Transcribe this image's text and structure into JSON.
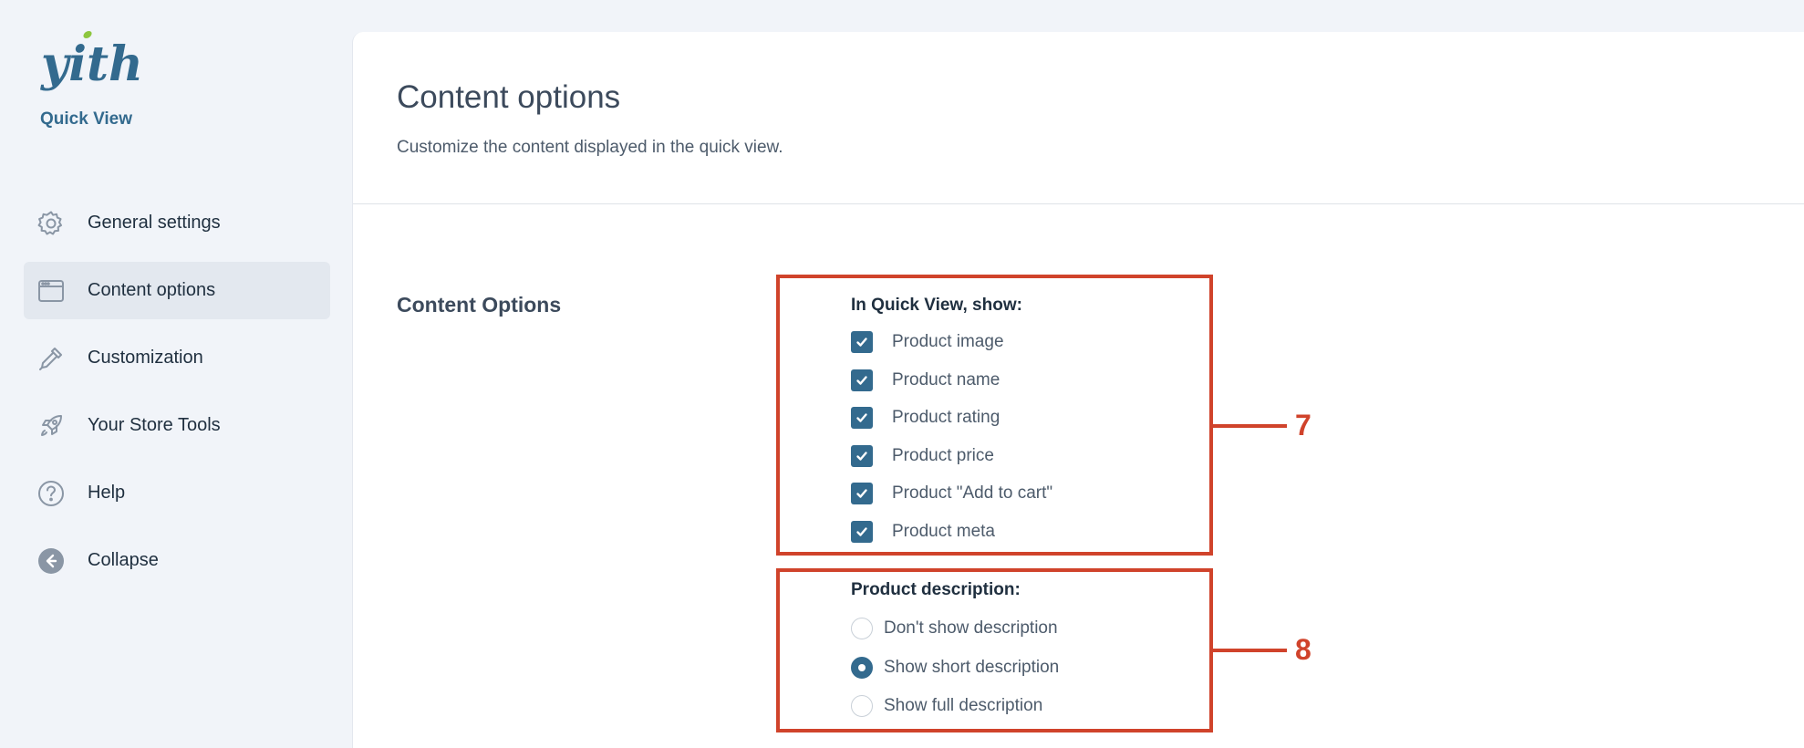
{
  "sidebar": {
    "logo_text": "yith",
    "plugin_name": "Quick View",
    "items": [
      {
        "label": "General settings",
        "icon": "gear-icon",
        "active": false
      },
      {
        "label": "Content options",
        "icon": "window-icon",
        "active": true
      },
      {
        "label": "Customization",
        "icon": "eyedropper-icon",
        "active": false
      },
      {
        "label": "Your Store Tools",
        "icon": "rocket-icon",
        "active": false
      },
      {
        "label": "Help",
        "icon": "help-circle-icon",
        "active": false
      },
      {
        "label": "Collapse",
        "icon": "arrow-left-circle-icon",
        "active": false
      }
    ]
  },
  "main": {
    "title": "Content options",
    "description": "Customize the content displayed in the quick view.",
    "section_label": "Content Options",
    "show_group": {
      "title": "In Quick View, show:",
      "options": [
        {
          "label": "Product image",
          "checked": true
        },
        {
          "label": "Product name",
          "checked": true
        },
        {
          "label": "Product rating",
          "checked": true
        },
        {
          "label": "Product price",
          "checked": true
        },
        {
          "label": "Product \"Add to cart\"",
          "checked": true
        },
        {
          "label": "Product meta",
          "checked": true
        }
      ]
    },
    "description_group": {
      "title": "Product description:",
      "options": [
        {
          "label": "Don't show description",
          "selected": false
        },
        {
          "label": "Show short description",
          "selected": true
        },
        {
          "label": "Show full description",
          "selected": false
        }
      ]
    }
  },
  "annotations": [
    {
      "number": "7"
    },
    {
      "number": "8"
    }
  ],
  "colors": {
    "accent": "#336a8e",
    "callout": "#d0432b",
    "logo_leaf": "#8dc63f"
  }
}
